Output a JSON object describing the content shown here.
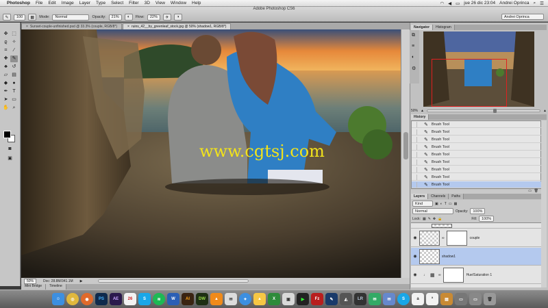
{
  "menubar": {
    "app": "Photoshop",
    "items": [
      "File",
      "Edit",
      "Image",
      "Layer",
      "Type",
      "Select",
      "Filter",
      "3D",
      "View",
      "Window",
      "Help"
    ],
    "clock": "jue 26 dic  23:04",
    "user": "Andrei Oprinca"
  },
  "window_title": "Adobe Photoshop CS6",
  "options": {
    "brush_size": "100",
    "mode_label": "Mode:",
    "mode_value": "Normal",
    "opacity_label": "Opacity:",
    "opacity_value": "21%",
    "flow_label": "Flow:",
    "flow_value": "22%",
    "workspace": "Andrei Oprinca"
  },
  "doc_tabs": [
    {
      "label": "Sunset-couple-unfinished.psd @ 33.3% (couple, RGB/8*)",
      "active": false
    },
    {
      "label": "ruins_42__by_greenleaf_stock.jpg @ 50% (shadow1, RGB/8*)",
      "active": true
    }
  ],
  "watermark": "www.cgtsj.com",
  "status": {
    "zoom": "50%",
    "doc": "Doc: 28.8M/341.1M"
  },
  "bottom_tabs": [
    "Mini Bridge",
    "Timeline"
  ],
  "navigator": {
    "tabs": [
      "Navigator",
      "Histogram"
    ],
    "zoom": "50%"
  },
  "history": {
    "tab": "History",
    "items": [
      "Brush Tool",
      "Brush Tool",
      "Brush Tool",
      "Brush Tool",
      "Brush Tool",
      "Brush Tool",
      "Brush Tool",
      "Brush Tool",
      "Brush Tool"
    ]
  },
  "layers_panel": {
    "tabs": [
      "Layers",
      "Channels",
      "Paths"
    ],
    "kind": "Kind",
    "blend": "Normal",
    "opacity_label": "Opacity:",
    "opacity": "100%",
    "lock_label": "Lock:",
    "fill_label": "Fill:",
    "fill": "100%",
    "layers": [
      {
        "name": "couple"
      },
      {
        "name": "shadow1"
      },
      {
        "name": "Hue/Saturation 1"
      }
    ]
  },
  "dock_icons": [
    "Finder",
    "Chrome",
    "Firefox",
    "PS",
    "AE",
    "Calendar",
    "Skype",
    "Spotify",
    "Word",
    "AI",
    "DW",
    "VLC",
    "Safari",
    "Drive",
    "Excel",
    "Photos",
    "Terminal",
    "FileZilla",
    "LR",
    "Messages",
    "Mail",
    "Notes",
    "Trash"
  ],
  "colors": {
    "accent": "#b4c9ee",
    "watermark": "#f2e31b"
  }
}
